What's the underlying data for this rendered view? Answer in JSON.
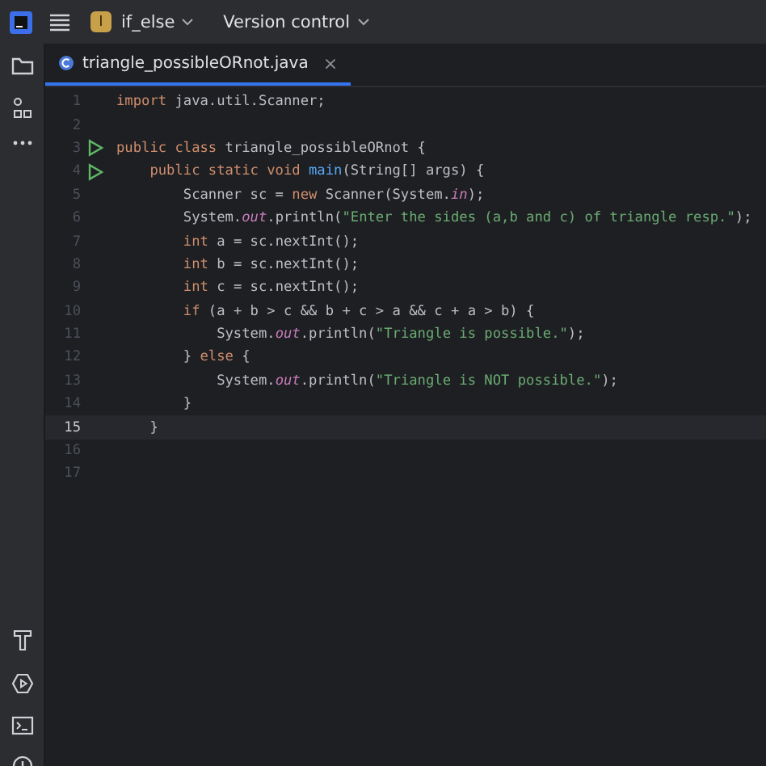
{
  "toolbar": {
    "project": {
      "badge": "I",
      "name": "if_else"
    },
    "vcs": "Version control"
  },
  "tabs": [
    {
      "label": "triangle_possibleORnot.java",
      "selected": true,
      "close": "×"
    }
  ],
  "lines": [
    {
      "number": "1",
      "run": false,
      "current": false,
      "tokens": [
        {
          "kind": "keyword",
          "text": "import"
        },
        {
          "kind": "plain",
          "text": " java.util.Scanner;"
        }
      ]
    },
    {
      "number": "2",
      "run": false,
      "current": false
    },
    {
      "number": "3",
      "run": true,
      "current": false,
      "tokens": [
        {
          "kind": "keyword",
          "text": "public class"
        },
        {
          "kind": "plain",
          "text": " triangle_possibleORnot {"
        }
      ]
    },
    {
      "number": "4",
      "run": true,
      "current": false,
      "tokens": [
        {
          "kind": "keyword",
          "text": "    public static void"
        },
        {
          "kind": "method",
          "text": " main"
        },
        {
          "kind": "plain",
          "text": "(String[] args) {"
        }
      ]
    },
    {
      "number": "5",
      "run": false,
      "current": false,
      "tokens": [
        {
          "kind": "plain",
          "text": "        Scanner sc = "
        },
        {
          "kind": "keyword",
          "text": "new"
        },
        {
          "kind": "plain",
          "text": " Scanner(System."
        },
        {
          "kind": "field",
          "text": "in"
        },
        {
          "kind": "plain",
          "text": ");"
        }
      ]
    },
    {
      "number": "6",
      "run": false,
      "current": false,
      "tokens": [
        {
          "kind": "plain",
          "text": "        System."
        },
        {
          "kind": "field",
          "text": "out"
        },
        {
          "kind": "plain",
          "text": ".println("
        },
        {
          "kind": "string",
          "text": "\"Enter the sides (a,b and c) of triangle resp.\""
        },
        {
          "kind": "plain",
          "text": ");"
        }
      ]
    },
    {
      "number": "7",
      "run": false,
      "current": false,
      "tokens": [
        {
          "kind": "keyword",
          "text": "        int"
        },
        {
          "kind": "plain",
          "text": " a = sc.nextInt();"
        }
      ]
    },
    {
      "number": "8",
      "run": false,
      "current": false,
      "tokens": [
        {
          "kind": "keyword",
          "text": "        int"
        },
        {
          "kind": "plain",
          "text": " b = sc.nextInt();"
        }
      ]
    },
    {
      "number": "9",
      "run": false,
      "current": false,
      "tokens": [
        {
          "kind": "keyword",
          "text": "        int"
        },
        {
          "kind": "plain",
          "text": " c = sc.nextInt();"
        }
      ]
    },
    {
      "number": "10",
      "run": false,
      "current": false,
      "tokens": [
        {
          "kind": "keyword",
          "text": "        if"
        },
        {
          "kind": "plain",
          "text": " (a + b > c && b + c > a && c + a > b) {"
        }
      ]
    },
    {
      "number": "11",
      "run": false,
      "current": false,
      "tokens": [
        {
          "kind": "plain",
          "text": "            System."
        },
        {
          "kind": "field",
          "text": "out"
        },
        {
          "kind": "plain",
          "text": ".println("
        },
        {
          "kind": "string",
          "text": "\"Triangle is possible.\""
        },
        {
          "kind": "plain",
          "text": ");"
        }
      ]
    },
    {
      "number": "12",
      "run": false,
      "current": false,
      "tokens": [
        {
          "kind": "plain",
          "text": "        } "
        },
        {
          "kind": "keyword",
          "text": "else"
        },
        {
          "kind": "plain",
          "text": " {"
        }
      ]
    },
    {
      "number": "13",
      "run": false,
      "current": false,
      "tokens": [
        {
          "kind": "plain",
          "text": "            System."
        },
        {
          "kind": "field",
          "text": "out"
        },
        {
          "kind": "plain",
          "text": ".println("
        },
        {
          "kind": "string",
          "text": "\"Triangle is NOT possible.\""
        },
        {
          "kind": "plain",
          "text": ");"
        }
      ]
    },
    {
      "number": "14",
      "run": false,
      "current": false,
      "tokens": [
        {
          "kind": "plain",
          "text": "        }"
        }
      ]
    },
    {
      "number": "15",
      "run": false,
      "current": true,
      "tokens": [
        {
          "kind": "plain",
          "text": "    }"
        }
      ]
    },
    {
      "number": "16",
      "run": false,
      "current": false
    },
    {
      "number": "17",
      "run": false,
      "current": false
    }
  ]
}
